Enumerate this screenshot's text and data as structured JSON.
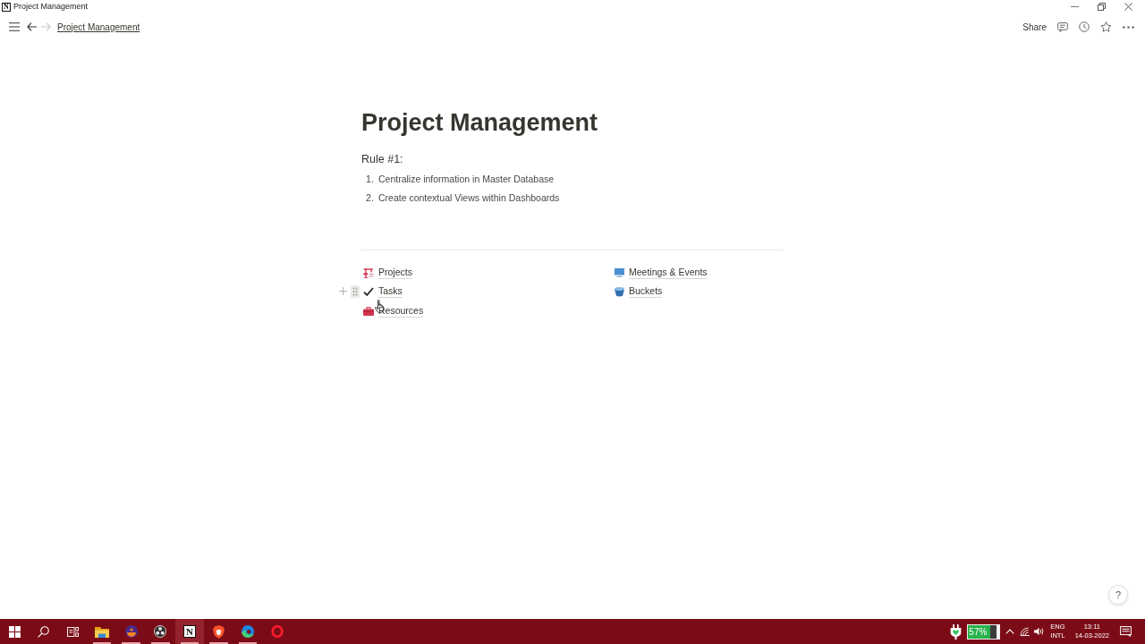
{
  "window": {
    "app_glyph": "N",
    "title": "Project Management"
  },
  "topbar": {
    "breadcrumb": "Project Management",
    "forward_disabled": true,
    "share": "Share"
  },
  "page": {
    "title": "Project Management",
    "heading": "Rule #1:",
    "list": [
      {
        "number": "1.",
        "text": "Centralize information in Master Database"
      },
      {
        "number": "2.",
        "text": "Create contextual Views within Dashboards"
      }
    ],
    "columns": [
      {
        "links": [
          {
            "kind": "projects",
            "label": "Projects",
            "hovered": false
          },
          {
            "kind": "tasks",
            "label": "Tasks",
            "hovered": true
          },
          {
            "kind": "resources",
            "label": "Resources",
            "hovered": false
          }
        ]
      },
      {
        "links": [
          {
            "kind": "meetings",
            "label": "Meetings & Events",
            "hovered": false
          },
          {
            "kind": "buckets",
            "label": "Buckets",
            "hovered": false
          }
        ]
      }
    ]
  },
  "help_button": "?",
  "taskbar": {
    "items": [
      {
        "kind": "start",
        "running": false,
        "selected": false
      },
      {
        "kind": "search",
        "running": false,
        "selected": false
      },
      {
        "kind": "taskview",
        "running": false,
        "selected": false
      },
      {
        "kind": "folder",
        "running": true,
        "selected": false
      },
      {
        "kind": "circle",
        "running": true,
        "selected": false
      },
      {
        "kind": "disc",
        "running": true,
        "selected": false
      },
      {
        "kind": "letter",
        "glyph": "N",
        "running": true,
        "selected": true
      },
      {
        "kind": "shield",
        "running": true,
        "selected": false
      },
      {
        "kind": "swirl",
        "running": true,
        "selected": false
      },
      {
        "kind": "ring",
        "running": false,
        "selected": false
      }
    ],
    "tray": {
      "battery": "57%",
      "language": "ENG",
      "layout": "INTL",
      "time": "13:11",
      "date": "14-03-2022"
    }
  }
}
